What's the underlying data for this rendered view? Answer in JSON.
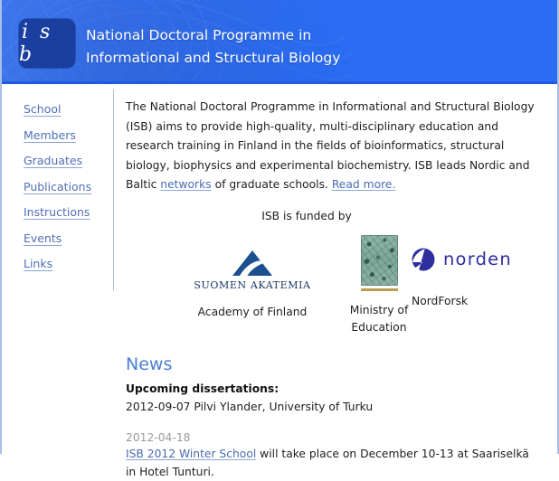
{
  "banner": {
    "logo_text": "i s b",
    "title_line1": "National Doctoral Programme in",
    "title_line2": "Informational and Structural Biology",
    "bg_color": "#2a6df4",
    "logo_bg_color": "#1a3fa0"
  },
  "sidebar": {
    "items": [
      {
        "label": "School"
      },
      {
        "label": "Members"
      },
      {
        "label": "Graduates"
      },
      {
        "label": "Publications"
      },
      {
        "label": "Instructions"
      },
      {
        "label": "Events"
      },
      {
        "label": "Links"
      }
    ],
    "link_color": "#4f6fb5"
  },
  "intro": {
    "part1": "The National Doctoral Programme in Informational and Structural Biology (ISB) aims to provide high-quality, multi-disciplinary education and research training in Finland in the fields of bioinformatics, structural biology, biophysics and experimental biochemistry. ISB leads Nordic and Baltic ",
    "link_networks": "networks",
    "part2": " of graduate schools. ",
    "link_read_more": "Read more."
  },
  "funders": {
    "heading": "ISB is funded by",
    "items": [
      {
        "logo_word": "SUOMEN AKATEMIA",
        "caption": "Academy of Finland",
        "logo_color": "#1c3766"
      },
      {
        "caption_line1": "Ministry of",
        "caption_line2": "Education",
        "plate_color": "#85ad9e",
        "bar_color": "#bb9d52"
      },
      {
        "logo_word": "norden",
        "caption": "NordForsk",
        "logo_color": "#2d2f9e"
      }
    ]
  },
  "news": {
    "heading": "News",
    "heading_color": "#4a7fd4",
    "entries": [
      {
        "subheading": "Upcoming dissertations:",
        "line": "2012-09-07 Pilvi Ylander, University of Turku"
      },
      {
        "date": "2012-04-18",
        "link": "ISB 2012 Winter School",
        "body": " will take place on December 10-13 at Saariselkä in Hotel Tunturi."
      }
    ]
  }
}
